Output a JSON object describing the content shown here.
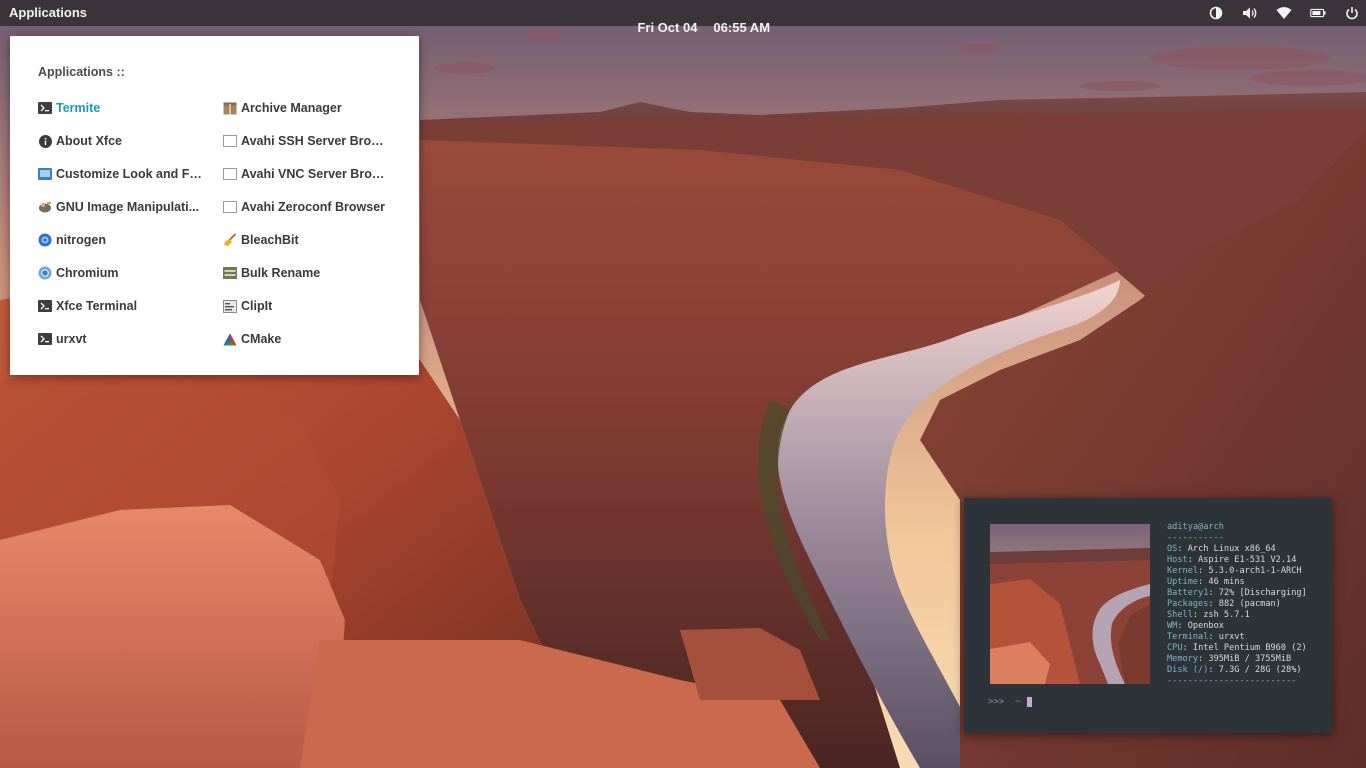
{
  "panel": {
    "applications_label": "Applications",
    "date": "Fri Oct 04",
    "time": "06:55 AM",
    "tray_icons": [
      "contrast-icon",
      "volume-icon",
      "wifi-icon",
      "battery-icon",
      "power-icon"
    ]
  },
  "menu": {
    "title": "Applications ::",
    "left_column": [
      {
        "label": "Termite",
        "icon": "terminal-icon",
        "active": true
      },
      {
        "label": "About Xfce",
        "icon": "info-icon"
      },
      {
        "label": "Customize Look and Feel",
        "icon": "appearance-icon"
      },
      {
        "label": "GNU Image Manipulati...",
        "icon": "gimp-icon"
      },
      {
        "label": "nitrogen",
        "icon": "nitrogen-icon"
      },
      {
        "label": "Chromium",
        "icon": "chromium-icon"
      },
      {
        "label": "Xfce Terminal",
        "icon": "terminal-icon"
      },
      {
        "label": "urxvt",
        "icon": "terminal-icon"
      }
    ],
    "right_column": [
      {
        "label": "Archive Manager",
        "icon": "archive-icon"
      },
      {
        "label": "Avahi SSH Server Browser",
        "icon": "blank-app-icon"
      },
      {
        "label": "Avahi VNC Server Brows...",
        "icon": "blank-app-icon"
      },
      {
        "label": "Avahi Zeroconf Browser",
        "icon": "blank-app-icon"
      },
      {
        "label": "BleachBit",
        "icon": "broom-icon"
      },
      {
        "label": "Bulk Rename",
        "icon": "rename-icon"
      },
      {
        "label": "ClipIt",
        "icon": "clipboard-icon"
      },
      {
        "label": "CMake",
        "icon": "cmake-icon"
      }
    ],
    "accent_color": "#1a9bb0"
  },
  "terminal": {
    "user_host": "aditya@arch",
    "separator_top": "-----------",
    "info": [
      {
        "key": "OS",
        "value": "Arch Linux x86_64"
      },
      {
        "key": "Host",
        "value": "Aspire E1-531 V2.14"
      },
      {
        "key": "Kernel",
        "value": "5.3.0-arch1-1-ARCH"
      },
      {
        "key": "Uptime",
        "value": "46 mins"
      },
      {
        "key": "Battery1",
        "value": "72% [Discharging]"
      },
      {
        "key": "Packages",
        "value": "882 (pacman)"
      },
      {
        "key": "Shell",
        "value": "zsh 5.7.1"
      },
      {
        "key": "WM",
        "value": "Openbox"
      },
      {
        "key": "Terminal",
        "value": "urxvt"
      },
      {
        "key": "CPU",
        "value": "Intel Pentium B960 (2)"
      },
      {
        "key": "Memory",
        "value": "395MiB / 3755MiB"
      },
      {
        "key": "Disk (/)",
        "value": "7.3G / 28G (28%)"
      }
    ],
    "separator_bottom": "-------------------------",
    "prompt": ">>>  ~"
  }
}
